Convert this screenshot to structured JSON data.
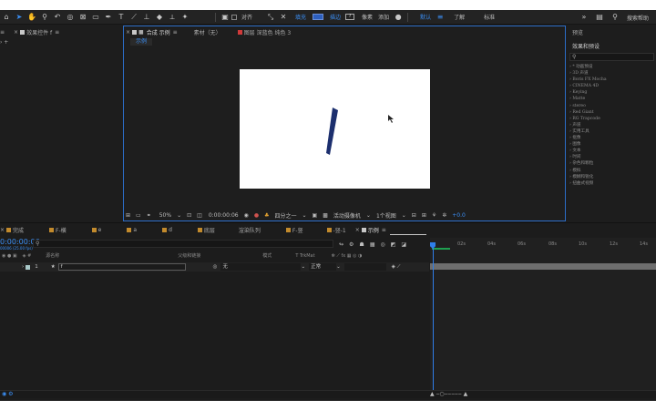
{
  "toolbar": {
    "align_label": "对齐",
    "fill_label": "填充",
    "stroke_label": "描边",
    "stroke_value": "?",
    "pixel_label": "像素",
    "add_label": "添加",
    "workspaces": [
      "默认",
      "了解",
      "标准"
    ],
    "search_label": "搜索帮助"
  },
  "panels": {
    "effect_controls_tab": "效果控件 f",
    "composition_tab": "合成 示例",
    "footage_tab": "素材（无）",
    "layer_tab": "图层 深蓝色 纯色 3",
    "comp_subtab": "示例",
    "preview_label": "预览"
  },
  "viewer": {
    "zoom": "50%",
    "timecode": "0:00:00:06",
    "resolution": "四分之一",
    "camera": "活动摄像机",
    "views": "1个视图",
    "exposure": "+0.0"
  },
  "effects_presets": {
    "title": "效果和预设",
    "items": [
      "* 动画预设",
      "3D 声道",
      "Boris FX Mocha",
      "CINEMA 4D",
      "Keying",
      "Matte",
      "stereo",
      "Red Giant",
      "RG Trapcode",
      "声道",
      "实用工具",
      "抠像",
      "图像",
      "文本",
      "时间",
      "杂色和颗粒",
      "模拟",
      "模糊和锐化",
      "扭曲式视频"
    ]
  },
  "timeline": {
    "tabs": [
      "完成",
      "F-横",
      "e",
      "a",
      "d",
      "底层",
      "渲染队列",
      "F-竖",
      "-竖-1",
      "示例"
    ],
    "timecode": "0:00:00:06",
    "timecode_sub": "00006 (25.00 fps)",
    "columns": {
      "name": "源名称",
      "parent": "父级和链接",
      "mode": "模式",
      "trkmat": "T  TrkMat"
    },
    "ruler_ticks": [
      "02s",
      "04s",
      "06s",
      "08s",
      "10s",
      "12s",
      "14s"
    ],
    "layers": [
      {
        "index": "1",
        "name": "f",
        "parent": "无",
        "mode": "正常"
      }
    ]
  },
  "colors": {
    "accent": "#2f7ee8",
    "stroke_shape": "#1c2f6e",
    "canvas": "#ffffff"
  }
}
